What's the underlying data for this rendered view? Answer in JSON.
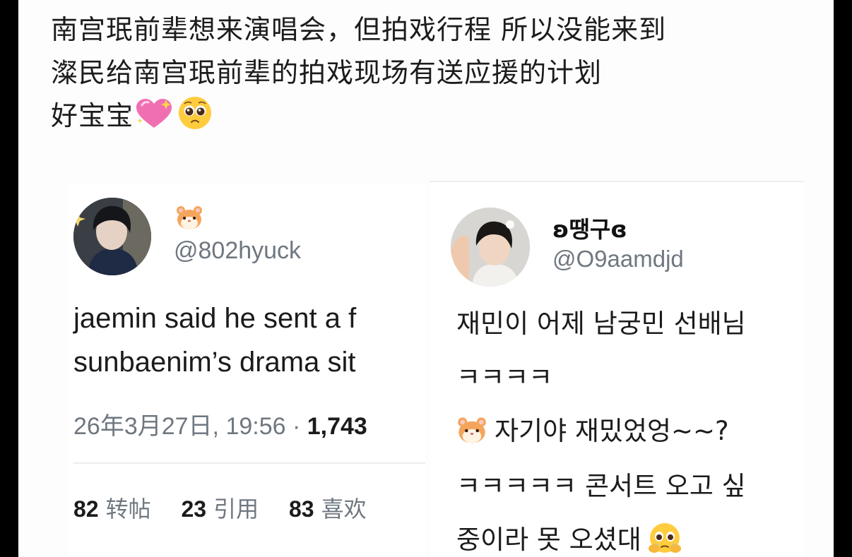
{
  "caption": {
    "line1": "南宫珉前辈想来演唱会，但拍戏行程 所以没能来到",
    "line2": "澯民给南宫珉前辈的拍戏现场有送应援的计划",
    "line3": "好宝宝",
    "emojis": [
      "sparkling-heart-icon",
      "pleading-face-icon"
    ]
  },
  "tweet_left": {
    "display_name_emoji": "hamster-face-icon",
    "handle": "@802hyuck",
    "text_line1": "jaemin said he sent a f",
    "text_line2": "sunbaenim’s drama sit",
    "date": "26年3月27日, 19:56 · ",
    "views": "1,743",
    "stats": [
      {
        "count": "82",
        "label": "转帖"
      },
      {
        "count": "23",
        "label": "引用"
      },
      {
        "count": "83",
        "label": "喜欢"
      }
    ]
  },
  "tweet_right": {
    "display_name": "ʚ땡구ɞ",
    "handle": "@O9aamdjd",
    "lines": [
      "재민이 어제 남궁민 선배님",
      "ㅋㅋㅋㅋ",
      "자기야 재밌었엉~~?",
      "ㅋㅋㅋㅋㅋ 콘서트 오고 싶",
      "중이라 못 오셨대"
    ],
    "line_emojis": [
      "hamster-face-icon",
      "face-holding-back-tears-icon"
    ]
  },
  "colors": {
    "background": "#fdfdfd",
    "text": "#1c1c1c",
    "secondary": "#6f7780",
    "divider": "#ebeef0",
    "heart": "#f06fb2"
  }
}
